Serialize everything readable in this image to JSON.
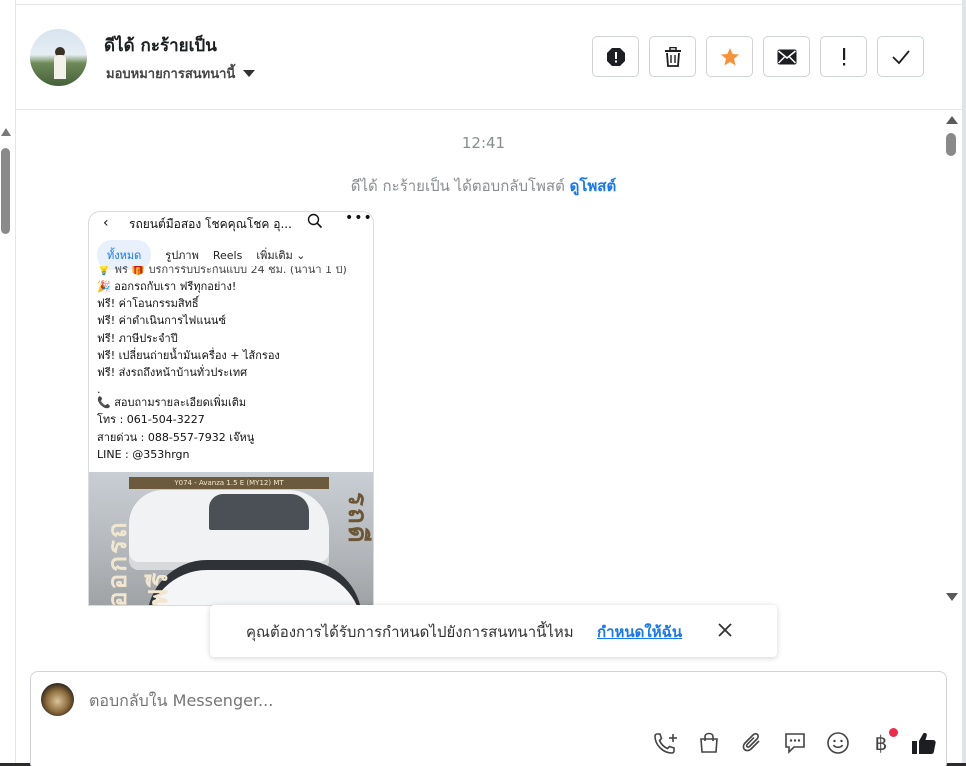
{
  "header": {
    "contact_name": "ดีได้ กะร้ายเป็น",
    "assign_label": "มอบหมายการสนทนานี้",
    "actions": [
      {
        "name": "spam",
        "icon": "alert-octagon-icon"
      },
      {
        "name": "delete",
        "icon": "trash-icon"
      },
      {
        "name": "star",
        "icon": "star-icon"
      },
      {
        "name": "mark-unread",
        "icon": "envelope-icon"
      },
      {
        "name": "follow-up",
        "icon": "exclamation-icon"
      },
      {
        "name": "done",
        "icon": "check-icon"
      }
    ],
    "accent_star": "#f7923b"
  },
  "conversation": {
    "timestamp": "12:41",
    "system_message": "ดีได้ กะร้ายเป็น ได้ตอบกลับโพสต์",
    "system_link": "ดูโพสต์",
    "post": {
      "page_title": "รถยนต์มือสอง โชคคุณโชค อุ...",
      "tabs": [
        "ทั้งหมด",
        "รูปภาพ",
        "Reels",
        "เพิ่มเติม"
      ],
      "lines": [
        "💡 ฟรี 🎁 บริการรับประกันแบบ 24 ชม. (นานา 1 ปี)",
        "🎉 ออกรถกับเรา ฟรีทุกอย่าง!",
        "ฟรี! ค่าโอนกรรมสิทธิ์",
        "ฟรี! ค่าดำเนินการไฟแนนซ์",
        "ฟรี! ภาษีประจำปี",
        "ฟรี! เปลี่ยนถ่ายน้ำมันเครื่อง + ไส้กรอง",
        "ฟรี! ส่งรถถึงหน้าบ้านทั่วประเทศ",
        ".",
        "📞 สอบถามรายละเอียดเพิ่มเติม",
        "โทร : 061-504-3227",
        "สายด่วน : 088-557-7932 เจ๊หนู",
        "LINE : @353hrgn"
      ],
      "image_banner": "Y074 - Avanza 1.5 E (MY12) MT",
      "image_text_left": "ออกรถฟรี",
      "image_text_right": "ราคา รถดี"
    }
  },
  "suggestion": {
    "question": "คุณต้องการได้รับการกำหนดไปยังการสนทนานี้ไหม",
    "action": "กำหนดให้ฉัน"
  },
  "composer": {
    "placeholder": "ตอบกลับใน Messenger...",
    "tools": [
      "call-add-icon",
      "shopping-bag-icon",
      "paperclip-icon",
      "chat-bubble-icon",
      "emoji-icon",
      "baht-icon",
      "thumbs-up-icon"
    ],
    "baht_symbol": "฿"
  }
}
